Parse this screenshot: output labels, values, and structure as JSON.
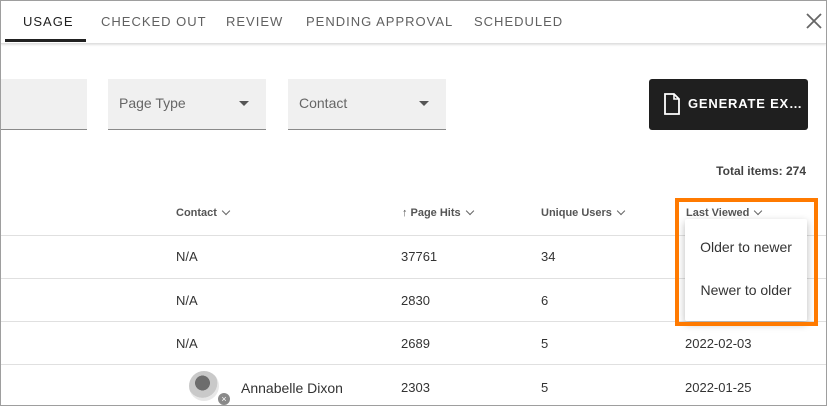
{
  "tabs": [
    {
      "label": "USAGE",
      "active": true
    },
    {
      "label": "CHECKED OUT",
      "active": false
    },
    {
      "label": "REVIEW",
      "active": false
    },
    {
      "label": "PENDING APPROVAL",
      "active": false
    },
    {
      "label": "SCHEDULED",
      "active": false
    }
  ],
  "close_icon": "close-icon",
  "filters": {
    "page_type": "Page Type",
    "contact": "Contact"
  },
  "generate_button": {
    "label": "GENERATE EX…",
    "icon": "document-icon"
  },
  "total_items": {
    "label": "Total items:",
    "value": "274"
  },
  "table": {
    "columns": {
      "contact": "Contact",
      "page_hits": "Page Hits",
      "unique_users": "Unique Users",
      "last_viewed": "Last Viewed"
    },
    "rows": [
      {
        "contact": "N/A",
        "page_hits": "37761",
        "unique_users": "34",
        "last_viewed": ""
      },
      {
        "contact": "N/A",
        "page_hits": "2830",
        "unique_users": "6",
        "last_viewed": ""
      },
      {
        "contact": "N/A",
        "page_hits": "2689",
        "unique_users": "5",
        "last_viewed": "2022-02-03"
      },
      {
        "contact": "Annabelle Dixon",
        "page_hits": "2303",
        "unique_users": "5",
        "last_viewed": "2022-01-25"
      }
    ]
  },
  "sort_menu": {
    "items": [
      "Older to newer",
      "Newer to older"
    ]
  },
  "colors": {
    "highlight": "#ff7a00",
    "button_bg": "#1f1f1f",
    "filter_bg": "#f0f0f0"
  }
}
